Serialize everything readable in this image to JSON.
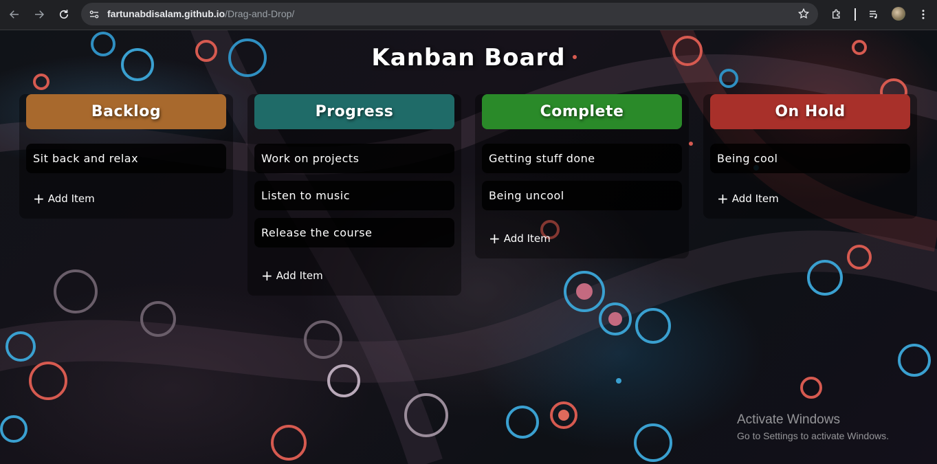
{
  "browser": {
    "url_host": "fartunabdisalam.github.io",
    "url_path": "/Drag-and-Drop/"
  },
  "page": {
    "title": "Kanban Board"
  },
  "columns": [
    {
      "name": "Backlog",
      "color": "#a8692d",
      "items": [
        "Sit back and relax"
      ],
      "add_label": "Add Item"
    },
    {
      "name": "Progress",
      "color": "#1f6b68",
      "items": [
        "Work on projects",
        "Listen to music",
        "Release the course"
      ],
      "add_label": "Add Item"
    },
    {
      "name": "Complete",
      "color": "#2a8a29",
      "items": [
        "Getting stuff done",
        "Being uncool"
      ],
      "add_label": "Add Item"
    },
    {
      "name": "On Hold",
      "color": "#a8302a",
      "items": [
        "Being cool"
      ],
      "add_label": "Add Item"
    }
  ],
  "watermark": {
    "line1": "Activate Windows",
    "line2": "Go to Settings to activate Windows."
  }
}
